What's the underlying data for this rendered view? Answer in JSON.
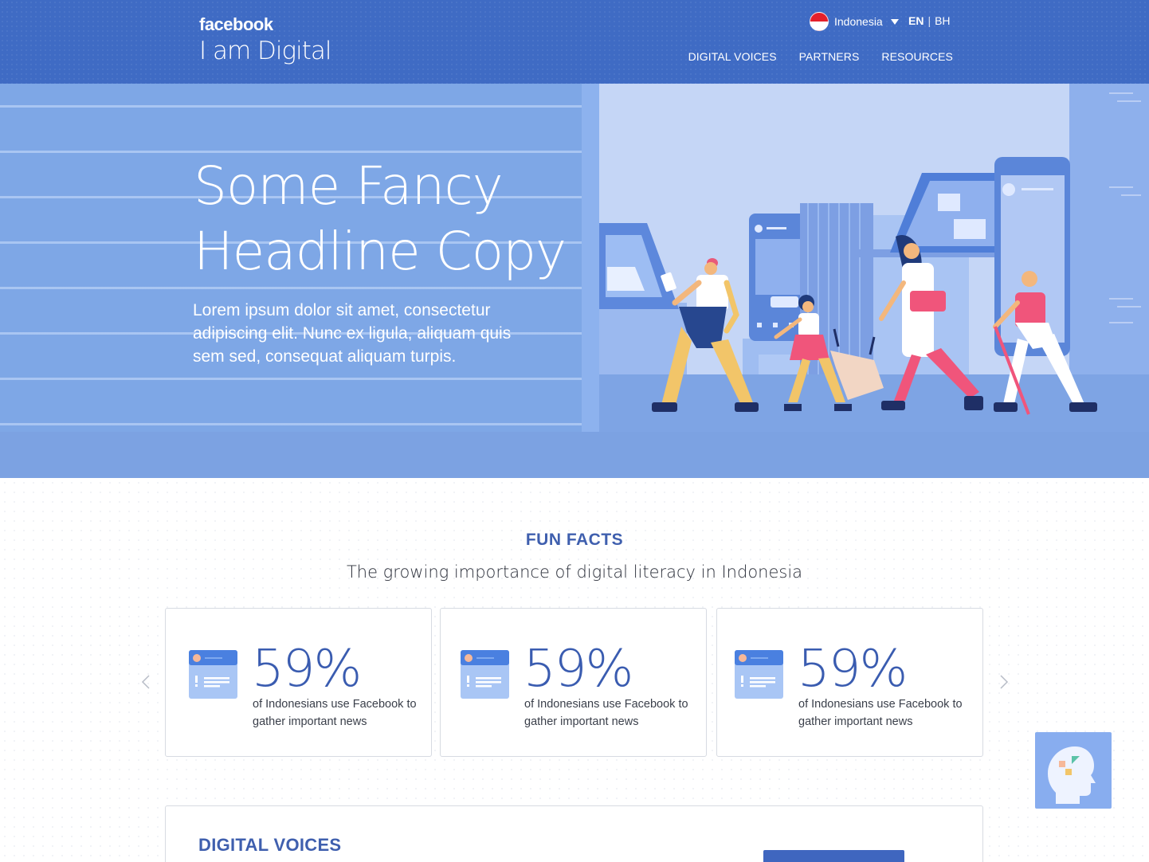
{
  "header": {
    "brand": "facebook",
    "site_title": "I am Digital",
    "country": "Indonesia",
    "languages": {
      "active": "EN",
      "separator": "|",
      "other": "BH"
    },
    "nav": [
      "DIGITAL VOICES",
      "PARTNERS",
      "RESOURCES"
    ]
  },
  "hero": {
    "headline": "Some Fancy Headline Copy",
    "subtext": "Lorem ipsum dolor sit amet, consectetur adipiscing elit. Nunc ex ligula, aliquam quis sem sed, consequat aliquam turpis."
  },
  "facts": {
    "eyebrow": "FUN FACTS",
    "subtitle": "The growing importance of digital literacy in Indonesia",
    "cards": [
      {
        "stat": "59%",
        "desc": "of Indonesians use Facebook to gather important news"
      },
      {
        "stat": "59%",
        "desc": "of Indonesians use Facebook to gather important news"
      },
      {
        "stat": "59%",
        "desc": "of Indonesians use Facebook to gather important news"
      }
    ]
  },
  "voices": {
    "title": "DIGITAL VOICES"
  },
  "icons": {
    "flag": "indonesia-flag-icon",
    "dropdown": "caret-down-icon",
    "prev": "chevron-left-icon",
    "next": "chevron-right-icon",
    "fact": "news-alert-icon",
    "widget": "head-puzzle-icon"
  },
  "colors": {
    "header": "#3f6bc4",
    "hero": "#7ea7e6",
    "accent": "#3f5fae",
    "stat": "#3a5cb0"
  }
}
